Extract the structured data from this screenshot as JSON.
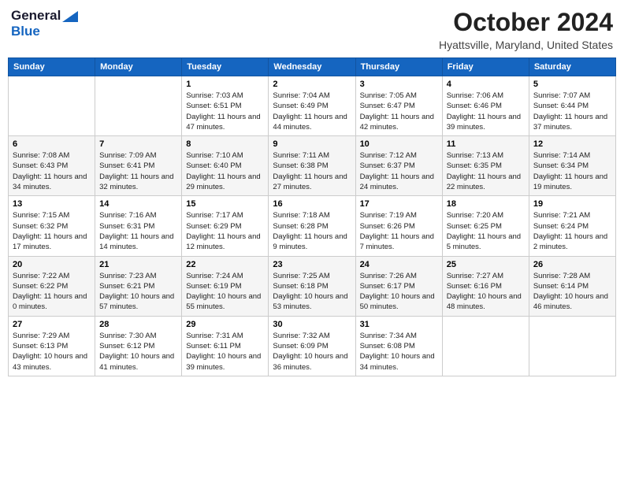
{
  "header": {
    "logo_line1": "General",
    "logo_line2": "Blue",
    "month": "October 2024",
    "location": "Hyattsville, Maryland, United States"
  },
  "weekdays": [
    "Sunday",
    "Monday",
    "Tuesday",
    "Wednesday",
    "Thursday",
    "Friday",
    "Saturday"
  ],
  "weeks": [
    [
      {
        "day": "",
        "info": ""
      },
      {
        "day": "",
        "info": ""
      },
      {
        "day": "1",
        "info": "Sunrise: 7:03 AM\nSunset: 6:51 PM\nDaylight: 11 hours and 47 minutes."
      },
      {
        "day": "2",
        "info": "Sunrise: 7:04 AM\nSunset: 6:49 PM\nDaylight: 11 hours and 44 minutes."
      },
      {
        "day": "3",
        "info": "Sunrise: 7:05 AM\nSunset: 6:47 PM\nDaylight: 11 hours and 42 minutes."
      },
      {
        "day": "4",
        "info": "Sunrise: 7:06 AM\nSunset: 6:46 PM\nDaylight: 11 hours and 39 minutes."
      },
      {
        "day": "5",
        "info": "Sunrise: 7:07 AM\nSunset: 6:44 PM\nDaylight: 11 hours and 37 minutes."
      }
    ],
    [
      {
        "day": "6",
        "info": "Sunrise: 7:08 AM\nSunset: 6:43 PM\nDaylight: 11 hours and 34 minutes."
      },
      {
        "day": "7",
        "info": "Sunrise: 7:09 AM\nSunset: 6:41 PM\nDaylight: 11 hours and 32 minutes."
      },
      {
        "day": "8",
        "info": "Sunrise: 7:10 AM\nSunset: 6:40 PM\nDaylight: 11 hours and 29 minutes."
      },
      {
        "day": "9",
        "info": "Sunrise: 7:11 AM\nSunset: 6:38 PM\nDaylight: 11 hours and 27 minutes."
      },
      {
        "day": "10",
        "info": "Sunrise: 7:12 AM\nSunset: 6:37 PM\nDaylight: 11 hours and 24 minutes."
      },
      {
        "day": "11",
        "info": "Sunrise: 7:13 AM\nSunset: 6:35 PM\nDaylight: 11 hours and 22 minutes."
      },
      {
        "day": "12",
        "info": "Sunrise: 7:14 AM\nSunset: 6:34 PM\nDaylight: 11 hours and 19 minutes."
      }
    ],
    [
      {
        "day": "13",
        "info": "Sunrise: 7:15 AM\nSunset: 6:32 PM\nDaylight: 11 hours and 17 minutes."
      },
      {
        "day": "14",
        "info": "Sunrise: 7:16 AM\nSunset: 6:31 PM\nDaylight: 11 hours and 14 minutes."
      },
      {
        "day": "15",
        "info": "Sunrise: 7:17 AM\nSunset: 6:29 PM\nDaylight: 11 hours and 12 minutes."
      },
      {
        "day": "16",
        "info": "Sunrise: 7:18 AM\nSunset: 6:28 PM\nDaylight: 11 hours and 9 minutes."
      },
      {
        "day": "17",
        "info": "Sunrise: 7:19 AM\nSunset: 6:26 PM\nDaylight: 11 hours and 7 minutes."
      },
      {
        "day": "18",
        "info": "Sunrise: 7:20 AM\nSunset: 6:25 PM\nDaylight: 11 hours and 5 minutes."
      },
      {
        "day": "19",
        "info": "Sunrise: 7:21 AM\nSunset: 6:24 PM\nDaylight: 11 hours and 2 minutes."
      }
    ],
    [
      {
        "day": "20",
        "info": "Sunrise: 7:22 AM\nSunset: 6:22 PM\nDaylight: 11 hours and 0 minutes."
      },
      {
        "day": "21",
        "info": "Sunrise: 7:23 AM\nSunset: 6:21 PM\nDaylight: 10 hours and 57 minutes."
      },
      {
        "day": "22",
        "info": "Sunrise: 7:24 AM\nSunset: 6:19 PM\nDaylight: 10 hours and 55 minutes."
      },
      {
        "day": "23",
        "info": "Sunrise: 7:25 AM\nSunset: 6:18 PM\nDaylight: 10 hours and 53 minutes."
      },
      {
        "day": "24",
        "info": "Sunrise: 7:26 AM\nSunset: 6:17 PM\nDaylight: 10 hours and 50 minutes."
      },
      {
        "day": "25",
        "info": "Sunrise: 7:27 AM\nSunset: 6:16 PM\nDaylight: 10 hours and 48 minutes."
      },
      {
        "day": "26",
        "info": "Sunrise: 7:28 AM\nSunset: 6:14 PM\nDaylight: 10 hours and 46 minutes."
      }
    ],
    [
      {
        "day": "27",
        "info": "Sunrise: 7:29 AM\nSunset: 6:13 PM\nDaylight: 10 hours and 43 minutes."
      },
      {
        "day": "28",
        "info": "Sunrise: 7:30 AM\nSunset: 6:12 PM\nDaylight: 10 hours and 41 minutes."
      },
      {
        "day": "29",
        "info": "Sunrise: 7:31 AM\nSunset: 6:11 PM\nDaylight: 10 hours and 39 minutes."
      },
      {
        "day": "30",
        "info": "Sunrise: 7:32 AM\nSunset: 6:09 PM\nDaylight: 10 hours and 36 minutes."
      },
      {
        "day": "31",
        "info": "Sunrise: 7:34 AM\nSunset: 6:08 PM\nDaylight: 10 hours and 34 minutes."
      },
      {
        "day": "",
        "info": ""
      },
      {
        "day": "",
        "info": ""
      }
    ]
  ]
}
